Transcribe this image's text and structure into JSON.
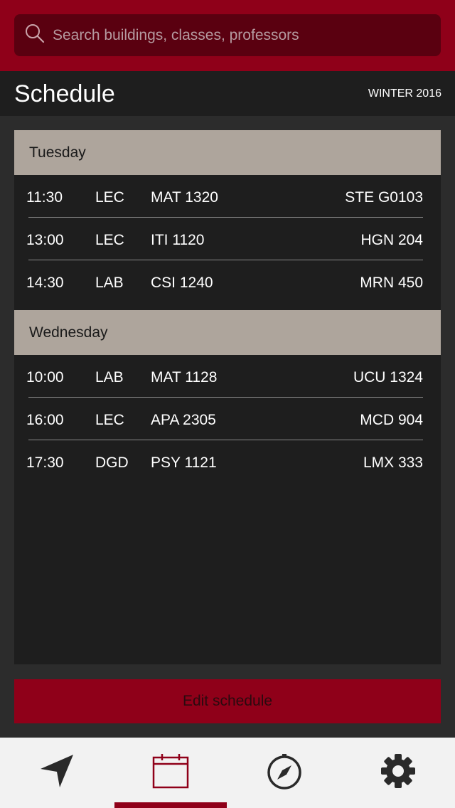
{
  "search": {
    "placeholder": "Search buildings, classes, professors"
  },
  "header": {
    "title": "Schedule",
    "term": "WINTER 2016"
  },
  "schedule": [
    {
      "day": "Tuesday",
      "classes": [
        {
          "time": "11:30",
          "type": "LEC",
          "course": "MAT 1320",
          "room": "STE G0103"
        },
        {
          "time": "13:00",
          "type": "LEC",
          "course": "ITI 1120",
          "room": "HGN 204"
        },
        {
          "time": "14:30",
          "type": "LAB",
          "course": "CSI 1240",
          "room": "MRN 450"
        }
      ]
    },
    {
      "day": "Wednesday",
      "classes": [
        {
          "time": "10:00",
          "type": "LAB",
          "course": "MAT 1128",
          "room": "UCU 1324"
        },
        {
          "time": "16:00",
          "type": "LEC",
          "course": "APA 2305",
          "room": "MCD 904"
        },
        {
          "time": "17:30",
          "type": "DGD",
          "course": "PSY 1121",
          "room": "LMX 333"
        }
      ]
    }
  ],
  "actions": {
    "edit_label": "Edit schedule"
  },
  "tabbar": {
    "active_tab": "schedule",
    "tabs": [
      {
        "id": "navigate",
        "icon": "navigation-arrow-icon"
      },
      {
        "id": "schedule",
        "icon": "calendar-icon"
      },
      {
        "id": "explore",
        "icon": "compass-icon"
      },
      {
        "id": "settings",
        "icon": "gear-icon"
      }
    ]
  },
  "colors": {
    "brand": "#8f0019",
    "day_header": "#aea59c",
    "panel": "#1e1e1e",
    "tab_active": "#8f0019",
    "tab_inactive": "#2a2a2a"
  }
}
